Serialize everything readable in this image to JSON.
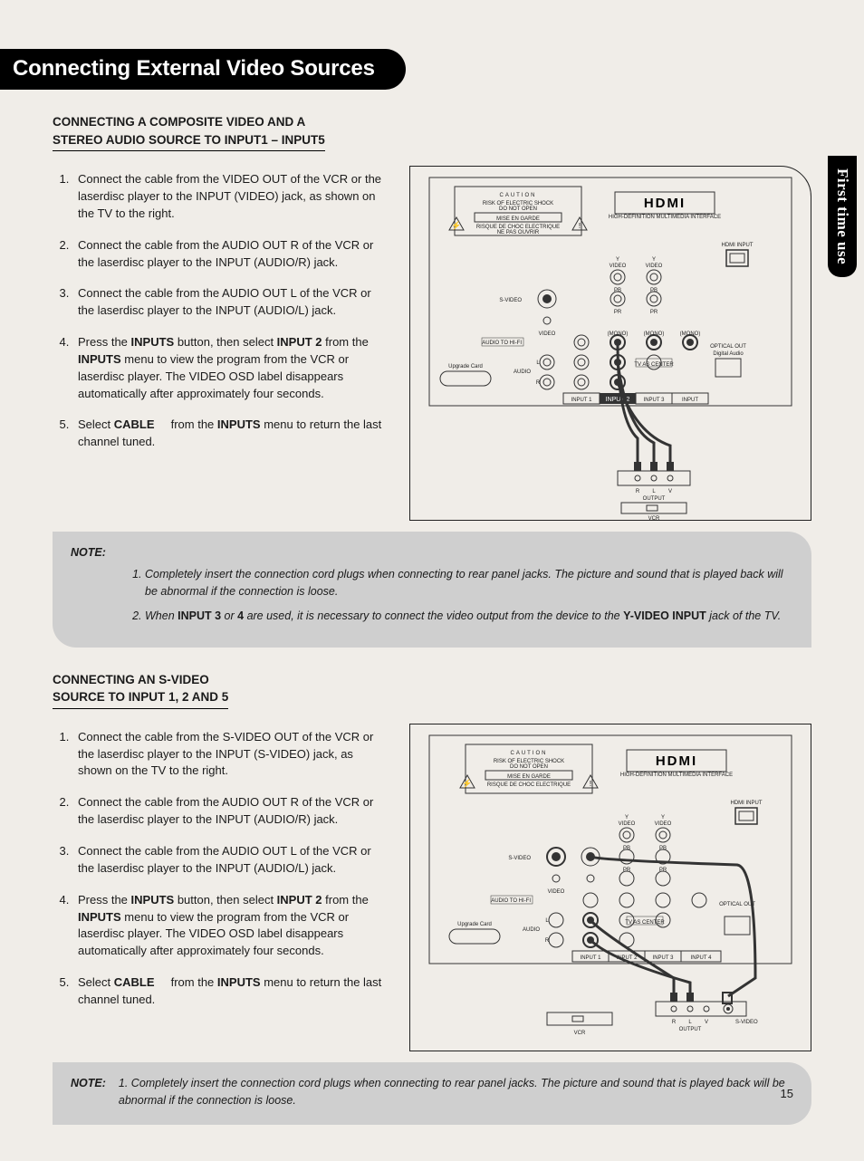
{
  "title": "Connecting External Video Sources",
  "sideTab": "First time use",
  "pageNumber": "15",
  "section1": {
    "heading_l1": "CONNECTING A COMPOSITE VIDEO AND A",
    "heading_l2": "STEREO AUDIO SOURCE TO INPUT1 – INPUT5",
    "steps": {
      "s1": "Connect the cable from the VIDEO OUT of the VCR or the laserdisc player to the INPUT (VIDEO) jack, as shown on the TV to the right.",
      "s2": "Connect the cable from the AUDIO OUT R of the VCR or the laserdisc player to the INPUT (AUDIO/R) jack.",
      "s3": "Connect the cable from the AUDIO OUT L of the VCR or the laserdisc player to the INPUT (AUDIO/L) jack.",
      "s4a": "Press the ",
      "s4b": "INPUTS",
      "s4c": " button, then select ",
      "s4d": "INPUT 2",
      "s4e": " from the ",
      "s4f": "INPUTS",
      "s4g": " menu to view the program from the VCR or laserdisc player. The VIDEO OSD label disappears automatically after approximately four seconds.",
      "s5a": "Select ",
      "s5b": "CABLE",
      "s5c": " from the ",
      "s5d": "INPUTS",
      "s5e": " menu to return the last channel tuned."
    },
    "diagram": {
      "caution": "CAUTION",
      "caution_l1": "RISK OF ELECTRIC SHOCK",
      "caution_l2": "DO NOT OPEN",
      "mise": "MISE EN GARDE",
      "mise_l1": "RISQUE DE CHOC ELECTRIQUE",
      "mise_l2": "NE PAS OUVRIR",
      "hdmi": "HDMI",
      "hdmi_sub": "HIGH-DEFINITION MULTIMEDIA INTERFACE",
      "hdmi_input": "HDMI INPUT",
      "video_y": "VIDEO",
      "video_y2": "VIDEO",
      "svideo": "S-VIDEO",
      "video": "VIDEO",
      "audio_hifi": "AUDIO TO HI-FI",
      "upgrade": "Upgrade Card",
      "audio": "AUDIO",
      "audioL": "L",
      "audioR": "R",
      "mono": "(MONO)",
      "tv_center": "TV AS CENTER",
      "optical": "OPTICAL OUT",
      "digital_audio": "Digital Audio",
      "input1": "INPUT 1",
      "input2": "INPUT 2",
      "input3": "INPUT 3",
      "input4": "INPUT",
      "pb": "PB",
      "pr": "PR",
      "out_r": "R",
      "out_l": "L",
      "out_v": "V",
      "out_label": "OUTPUT",
      "vcr": "VCR"
    }
  },
  "note1": {
    "label": "NOTE:",
    "n1a": "Completely insert the connection cord plugs when connecting to rear panel jacks. The picture and sound that is played back will be abnormal if the connection is loose.",
    "n2a": "When ",
    "n2b": "INPUT 3",
    "n2c": " or ",
    "n2d": "4",
    "n2e": " are used, it is necessary to connect the video output from the device to the ",
    "n2f": "Y-VIDEO INPUT",
    "n2g": " jack of the TV."
  },
  "section2": {
    "heading_l1": "CONNECTING AN S-VIDEO",
    "heading_l2": "SOURCE TO INPUT 1, 2 AND 5",
    "steps": {
      "s1": "Connect the cable from the S-VIDEO OUT of the VCR or the laserdisc player to the INPUT (S-VIDEO) jack, as shown on the TV to the right.",
      "s2": "Connect the cable from the AUDIO OUT R of the VCR or the laserdisc player to the INPUT (AUDIO/R) jack.",
      "s3": "Connect the cable from the AUDIO OUT L of the VCR or the laserdisc player to the INPUT (AUDIO/L) jack.",
      "s4a": "Press the ",
      "s4b": "INPUTS",
      "s4c": " button, then select ",
      "s4d": "INPUT 2",
      "s4e": " from the ",
      "s4f": "INPUTS",
      "s4g": " menu to view the program from the VCR or laserdisc player. The VIDEO OSD label disappears automatically after approximately four seconds.",
      "s5a": "Select ",
      "s5b": "CABLE",
      "s5c": " from the ",
      "s5d": "INPUTS",
      "s5e": " menu to return the last channel tuned."
    },
    "diagram": {
      "svideo_out": "S-VIDEO",
      "output": "OUTPUT"
    }
  },
  "note2": {
    "label": "NOTE:",
    "n1a": "1.  Completely insert the connection cord plugs when connecting to rear panel jacks. The picture and sound that is played back will be abnormal if the connection is loose."
  }
}
